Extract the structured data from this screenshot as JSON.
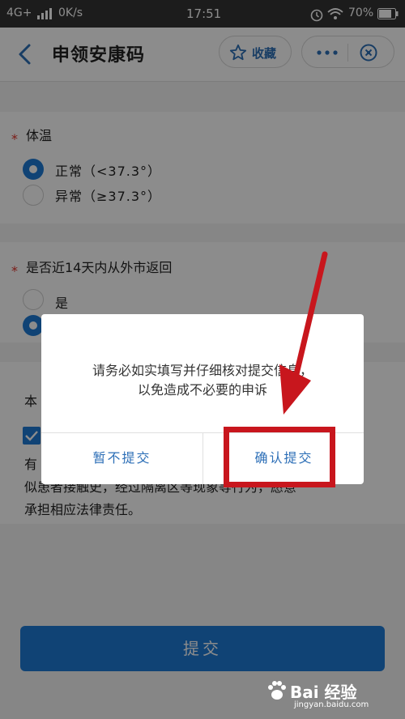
{
  "status_bar": {
    "network": "4G+",
    "speed": "0K/s",
    "time": "17:51",
    "battery": "70%"
  },
  "header": {
    "title": "申领安康码",
    "favorite_label": "收藏"
  },
  "questions": [
    {
      "label": "体温",
      "options": [
        "正常（<37.3°）",
        "异常（≥37.3°）"
      ],
      "selected": 0
    },
    {
      "label": "是否近14天内从外市返回",
      "options": [
        "是",
        ""
      ],
      "selected": 1
    }
  ],
  "statement": {
    "prefix": "本",
    "lines": [
      "有",
      "似患者接触史，经过隔离区等现象等行为，愿意",
      "承担相应法律责任。"
    ]
  },
  "submit_label": "提交",
  "dialog": {
    "message_line1": "请务必如实填写并仔细核对提交信息，",
    "message_line2": "以免造成不必要的申诉",
    "cancel_label": "暂不提交",
    "confirm_label": "确认提交"
  },
  "watermark": {
    "brand": "Bai 经验",
    "url": "jingyan.baidu.com"
  },
  "colors": {
    "accent": "#1e7bd6",
    "link": "#2d6fb7",
    "required": "#e0322a",
    "highlight": "#c8161d"
  }
}
